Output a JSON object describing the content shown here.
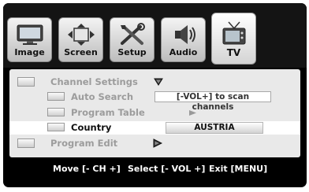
{
  "tabs": [
    {
      "label": "Image",
      "icon": "monitor-icon"
    },
    {
      "label": "Screen",
      "icon": "resize-arrows-icon"
    },
    {
      "label": "Setup",
      "icon": "tools-icon"
    },
    {
      "label": "Audio",
      "icon": "speaker-icon"
    },
    {
      "label": "TV",
      "icon": "tv-antenna-icon",
      "active": true
    }
  ],
  "menu": {
    "channel_settings": "Channel Settings",
    "auto_search": "Auto Search",
    "auto_search_value": "[-VOL+] to scan channels",
    "program_table": "Program Table",
    "country": "Country",
    "country_value": "AUSTRIA",
    "program_edit": "Program Edit"
  },
  "hints": {
    "move": "Move [- CH +]",
    "select": "Select [- VOL +]",
    "exit": "Exit [MENU]"
  },
  "colors": {
    "background": "#000000",
    "panel": "#e9e9e9",
    "selected_row": "#ffffff",
    "inactive_text": "#9c9c9c"
  }
}
